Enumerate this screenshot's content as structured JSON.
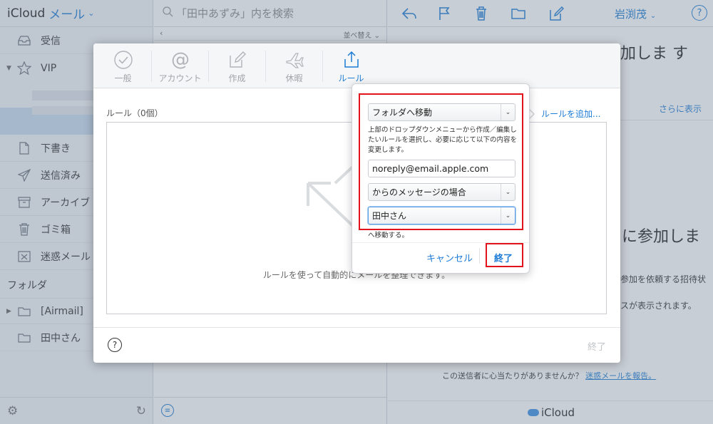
{
  "sidebar": {
    "brand": "iCloud",
    "app": "メール",
    "items": [
      {
        "label": "受信",
        "icon": "inbox-icon"
      },
      {
        "label": "VIP",
        "icon": "star-icon"
      },
      {
        "label": "下書き",
        "icon": "document-icon"
      },
      {
        "label": "送信済み",
        "icon": "paper-plane-icon"
      },
      {
        "label": "アーカイブ",
        "icon": "archive-box-icon"
      },
      {
        "label": "ゴミ箱",
        "icon": "trash-icon"
      },
      {
        "label": "迷惑メール",
        "icon": "junk-icon"
      }
    ],
    "folders_heading": "フォルダ",
    "folders": [
      {
        "label": "[Airmail]",
        "icon": "folder-icon"
      },
      {
        "label": "田中さん",
        "icon": "folder-icon"
      }
    ]
  },
  "message_list": {
    "search_placeholder": "「田中あずみ」内を検索",
    "sort_label": "並べ替え"
  },
  "viewer": {
    "user_name": "岩渕茂",
    "title_fragment_1": "加しま す",
    "more_link": "さらに表示",
    "title_fragment_2": "に参加しま",
    "body_fragment_1": "参加を依頼する招待状",
    "body_fragment_2": "スが表示されます。",
    "junk_question": "この送信者に心当たりがありませんか？",
    "junk_link": "迷惑メールを報告。",
    "footer_brand": "iCloud"
  },
  "preferences": {
    "tabs": [
      {
        "label": "一般",
        "icon": "checkmark-circle-icon",
        "active": false
      },
      {
        "label": "アカウント",
        "icon": "at-sign-icon",
        "active": false
      },
      {
        "label": "作成",
        "icon": "compose-icon",
        "active": false
      },
      {
        "label": "休暇",
        "icon": "airplane-icon",
        "active": false
      },
      {
        "label": "ルール",
        "icon": "move-arrows-icon",
        "active": true
      }
    ],
    "rules_label": "ルール（0個）",
    "add_rule_link": "ルールを追加...",
    "empty_text": "ルールを使って自動的にメールを整理できます。",
    "done_label": "終了"
  },
  "rule_popover": {
    "action_select": "フォルダへ移動",
    "description": "上部のドロップダウンメニューから作成／編集したいルールを選択し、必要に応じて以下の内容を変更します。",
    "email_value": "noreply@email.apple.com",
    "condition_select": "からのメッセージの場合",
    "folder_select": "田中さん",
    "move_suffix": "へ移動する。",
    "cancel_label": "キャンセル",
    "done_label": "終了"
  },
  "colors": {
    "accent": "#1d7cd6",
    "highlight": "#e3131b"
  }
}
